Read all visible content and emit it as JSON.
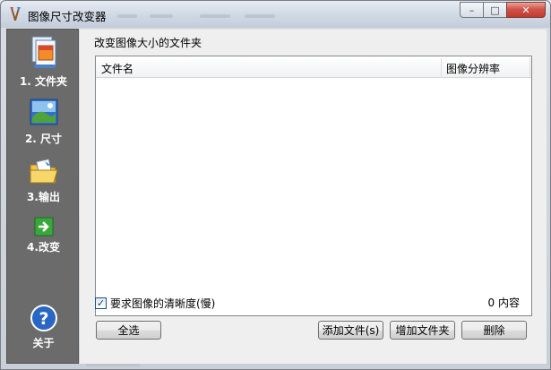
{
  "window": {
    "title": "图像尺寸改变器",
    "minimize_glyph": "–",
    "maximize_glyph": "□",
    "close_glyph": "✕"
  },
  "sidebar": {
    "items": [
      {
        "label": "1. 文件夹",
        "icon": "folder-files-icon"
      },
      {
        "label": "2. 尺寸",
        "icon": "picture-icon"
      },
      {
        "label": "3.输出",
        "icon": "output-folder-icon"
      },
      {
        "label": "4.改变",
        "icon": "green-arrow-icon"
      }
    ],
    "about": {
      "label": "关于",
      "icon": "help-icon"
    }
  },
  "main": {
    "group_title": "改变图像大小的文件夹",
    "columns": [
      "文件名",
      "图像分辨率"
    ],
    "rows": [],
    "quality_checkbox": {
      "label": "要求图像的清晰度(慢)",
      "checked": true
    },
    "count_text": "0 内容",
    "buttons": {
      "select_all": "全选",
      "add_file": "添加文件(s)",
      "add_folder": "增加文件夹",
      "delete": "删除"
    }
  },
  "colors": {
    "sidebar_bg": "#6b6b6b",
    "close_button": "#c9453a"
  }
}
